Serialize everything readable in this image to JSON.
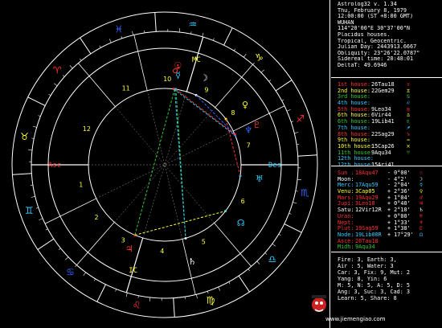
{
  "header": {
    "lines": [
      "Astrolog32 v. 1.34",
      "Thu, February 8, 1979",
      "12:00:00 (ST +8:00 GMT)",
      "WUHAN",
      "114°20'00\"E 30°37'00\"N",
      "Placidus houses.",
      "Tropical, Geocentric.",
      "Julian Day: 2443913.6667",
      "Obliquity: 23°26'22.0787\"",
      "Sidereal time: 20:48:01",
      "DeltaT: 49.6946"
    ]
  },
  "houses": [
    {
      "label": "1st house:",
      "value": "26Tau18",
      "color": "#ff3333",
      "sym": "♉"
    },
    {
      "label": "2nd house:",
      "value": "22Gem29",
      "color": "#ffff33",
      "sym": "♊"
    },
    {
      "label": "3rd house:",
      "value": "",
      "color": "#33cc33",
      "sym": "♋"
    },
    {
      "label": "4th house:",
      "value": "",
      "color": "#33ccff",
      "sym": "♌"
    },
    {
      "label": "5th house:",
      "value": "9Leo34",
      "color": "#ff3333",
      "sym": "♍"
    },
    {
      "label": "6th house:",
      "value": "6Vir44",
      "color": "#ffff33",
      "sym": "♎"
    },
    {
      "label": "6th house:",
      "value": "19Lib41",
      "color": "#33cc33",
      "sym": "♏"
    },
    {
      "label": "7th house:",
      "value": "",
      "color": "#33ccff",
      "sym": "♐"
    },
    {
      "label": "8th house:",
      "value": "22Sag29",
      "color": "#ff3333",
      "sym": "♑"
    },
    {
      "label": "9th house:",
      "value": "",
      "color": "#ffff33",
      "sym": "♒"
    },
    {
      "label": "10th house:",
      "value": "15Cap26",
      "color": "#ffff33",
      "sym": "♓"
    },
    {
      "label": "11th house:",
      "value": "9Aqu34",
      "color": "#33cc33",
      "sym": "♈"
    },
    {
      "label": "12th house:",
      "value": "",
      "color": "#33ccff",
      "sym": ""
    },
    {
      "label": "12th house:",
      "value": "15Ari41",
      "color": "#33ccff",
      "sym": ""
    }
  ],
  "planets": [
    {
      "name": "Sun :",
      "value": "18Aqu47",
      "dec": "- 0°00'",
      "color": "#ff3333",
      "sym": "☉"
    },
    {
      "name": "Moon:",
      "value": "",
      "dec": "- 4°2'",
      "color": "#ffffff",
      "sym": "☽"
    },
    {
      "name": "Merc:",
      "value": "17Aqu59",
      "dec": "- 2°04'",
      "color": "#33ccff",
      "sym": "☿"
    },
    {
      "name": "Venu:",
      "value": "3Cap05",
      "dec": "+ 2°36'",
      "color": "#ffff33",
      "sym": "♀"
    },
    {
      "name": "Mars:",
      "value": "19Aqu29",
      "dec": "+ 1°04'",
      "color": "#ff3333",
      "sym": "♂"
    },
    {
      "name": "Jupi:",
      "value": "3Leo18",
      "dec": "+ 0°40'",
      "color": "#ff3333",
      "sym": "♃"
    },
    {
      "name": "Satu:",
      "value": "12Vir12R",
      "dec": "+ 2°10'",
      "color": "#ffffff",
      "sym": "♄"
    },
    {
      "name": "Uran:",
      "value": "",
      "dec": "+ 0°00'",
      "color": "#ff3333",
      "sym": "♅"
    },
    {
      "name": "Nept:",
      "value": "",
      "dec": "+ 1°33'",
      "color": "#ff3333",
      "sym": "♆"
    },
    {
      "name": "Plut:",
      "value": "19Sag59",
      "dec": "+ 1°38'",
      "color": "#ff3333",
      "sym": "♇"
    },
    {
      "name": "Node:",
      "value": "19Lib00R",
      "dec": "+ 17°29'",
      "color": "#33ccff",
      "sym": "☊"
    },
    {
      "name": "Asce:",
      "value": "26Tau18",
      "dec": "",
      "color": "#ff3333",
      "sym": ""
    },
    {
      "name": "Midh:",
      "value": "9Aqu34",
      "dec": "",
      "color": "#33cc33",
      "sym": ""
    }
  ],
  "elements": [
    "Fire: 3, Earth: 3,",
    "Air : 5, Water: 3",
    "Car: 3, Fix: 9, Mut: 2",
    "Yang: 8, Yin: 6",
    "M: 5, N: 5, A: 5, D: 5",
    "Ang: 3, Suc: 3, Cad: 3",
    "Learn: 5, Share: 8"
  ],
  "chart_labels": {
    "asc": "Asc",
    "des": "Des",
    "mc": "MC",
    "ic": "IC"
  },
  "house_numbers": [
    "1",
    "2",
    "3",
    "4",
    "5",
    "6",
    "7",
    "8",
    "9",
    "10",
    "11",
    "12"
  ],
  "watermark": "www.jiemengiao.com",
  "colors": {
    "red": "#ff3333",
    "yellow": "#ffff33",
    "green": "#33cc33",
    "cyan": "#33ccff",
    "blue": "#3366ff",
    "white": "#ffffff"
  }
}
